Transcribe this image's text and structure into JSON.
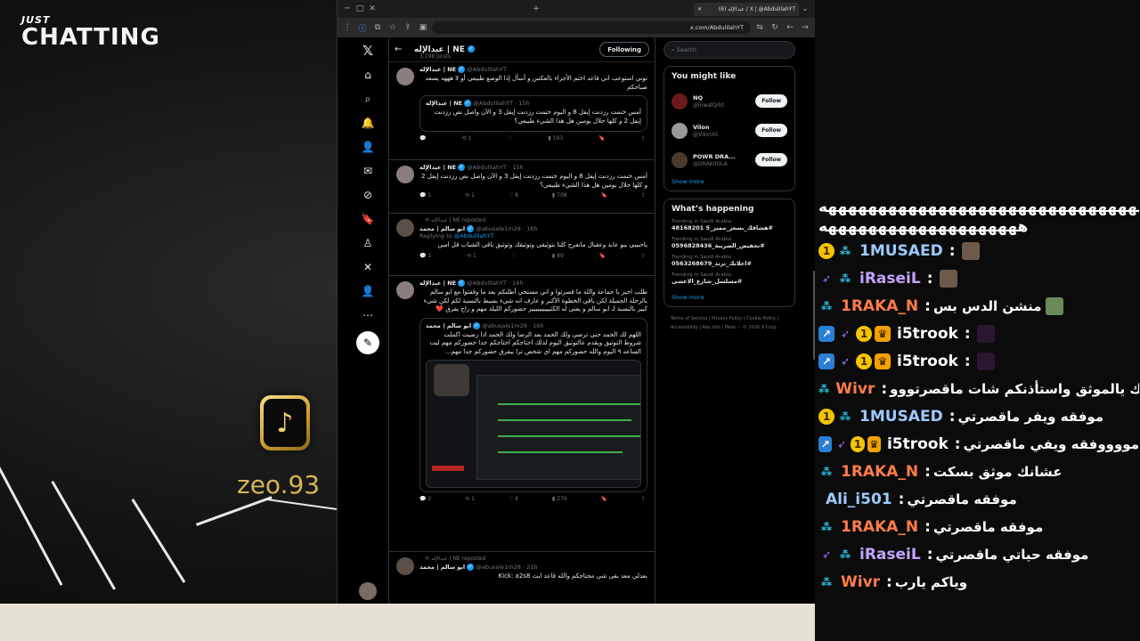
{
  "stream": {
    "category_top": "JUST",
    "category_main": "CHATTING",
    "tiktok_handle": "zeo.93",
    "tiktok_glyph": "♪"
  },
  "browser": {
    "tab_title": "عبدالإله (6) / X | @AbdulilahYT",
    "url": "x.com/AbdulilahYT"
  },
  "x": {
    "logo": "𝕏",
    "profile_name": "عبدالإله | NE",
    "post_count": "3,198 posts",
    "follow_state": "Following",
    "search_placeholder": "Search",
    "tweets": [
      {
        "author": "عبدالإله | NE",
        "handle": "@AbdulilahYT",
        "time": "",
        "text": "توني استوعب اني قاعد اختم الأجزاء بالعكس و أسأل إذا الوضع طبيعي أو لا هههه يسعد صباحكم",
        "quote_author": "عبدالإله | NE",
        "quote_handle": "@AbdulilahYT · 15h",
        "quote_text": "أمس ختمت رزدنت إيفل 8 و اليوم ختمت رزدنت إيفل 3 و الآن واصل نص رزدنت إيفل 2 و كلها خلال يومين هل هذا الشيء طبيعي؟",
        "replies": "",
        "reposts": "1",
        "likes": "",
        "views": "193"
      },
      {
        "author": "عبدالإله | NE",
        "handle": "@AbdulilahYT · 15h",
        "text": "أمس ختمت رزدنت إيفل 8 و اليوم ختمت رزدنت إيفل 3 و الآن واصل نص رزدنت إيفل 2 و كلها خلال يومين هل هذا الشيء طبيعي؟",
        "replies": "1",
        "reposts": "1",
        "likes": "8",
        "views": "708"
      },
      {
        "repost_by": "عبدالإله | NE reposted",
        "author": "ابو سالم | محمد",
        "handle": "@abusale1m28 · 16h",
        "reply_to_prefix": "Replying to",
        "reply_to": "@AbdulilahYT",
        "text": "ياحبيبي يبو عابد وعقبال مانفرح كلنا بتوثيقي وتوثيقك وتوثيق باقي الشباب قل امين",
        "replies": "1",
        "reposts": "1",
        "likes": "",
        "views": "89"
      },
      {
        "author": "عبدالإله | NE",
        "handle": "@AbdulilahYT · 16h",
        "text": "طلب اخير يا جماعة والله ما قصرتوا و اني مستحي أطلبكم بعد ما وقفتوا مع ابو سالم بالرحلة الجميلة لكن باقي الخطوة الأكبر و عارف انه شيء بسيط بالنسبة لكم لكن شيء كبير بالنسبة لـ ابو سالم و يعني له الكثيييييييييير حضوركم الليلة مهم و راح يفرق ❤️",
        "quote_author": "ابو سالم | محمد",
        "quote_handle": "@abusale1m28 · 16h",
        "quote_text": "اللهم لك الحمد حتى ترضى ولك الحمد بعد الرضا ولك الحمد اذا رضيت اكملت شروط التوثيق ويقدم عالتوثيق اليوم لذلك احتاجكم احتاجكم جدا حضوركم مهم ليت الساعه ٩ اليوم والله حضوركم مهم اي شخص ترا بيفرق حضوركم جدا مهم...",
        "replies": "2",
        "reposts": "1",
        "likes": "4",
        "views": "279"
      },
      {
        "repost_by": "عبدالإله | NE reposted",
        "author": "ابو سالم | محمد",
        "handle": "@abusale1m28 · 21h",
        "text": "بعدلي معد بقى شي محتاجكم والله قاعد ابث Kick: a2s8"
      }
    ],
    "who_to_follow": {
      "title": "You might like",
      "follow_label": "Follow",
      "show_more": "Show more",
      "accounts": [
        {
          "name": "NQ",
          "handle": "@lnwafQiht"
        },
        {
          "name": "Vilon",
          "handle": "@Vilon45"
        },
        {
          "name": "POWR DRA...",
          "handle": "@DRAK0OLA"
        }
      ]
    },
    "happening": {
      "title": "What’s happening",
      "show_more": "Show more",
      "trends": [
        {
          "context": "Trending in Saudi Arabia",
          "tag": "#هشاقك_بسعر_مميز_5 48168201"
        },
        {
          "context": "Trending in Saudi Arabia",
          "tag": "#تخفيض_الضريبة_0596828436"
        },
        {
          "context": "Trending in Saudi Arabia",
          "tag": "#اعلانك_ترند_0563268679"
        },
        {
          "context": "Trending in Saudi Arabia",
          "tag": "#مسلسل_شارع_الاعشى"
        }
      ]
    },
    "footer": {
      "links": "Terms of Service | Privacy Policy | Cookie Policy | Accessibility | Ads info | More ··· © 2026 X Corp."
    }
  },
  "chat": {
    "spam_line_1": "ههههههههههههههههههههههههههههههههههه",
    "spam_line_2": "ههههههههههههههههههههه",
    "messages": [
      {
        "user": "1MUSAED",
        "color": "#9ccaff",
        "text": ""
      },
      {
        "user": "iRaseiL",
        "color": "#c2a4ff",
        "text": ""
      },
      {
        "user": "1RAKA_N",
        "color": "#ff7b4a",
        "text": "منشن الدس بس"
      },
      {
        "user": "i5trook",
        "color": "#ffffff",
        "text": ""
      },
      {
        "user": "i5trook",
        "color": "#ffffff",
        "text": ""
      },
      {
        "user": "Wivr",
        "color": "#ff7b4a",
        "text": "استأذنك يالموثق واستأذنكم شات ماقصرتووو"
      },
      {
        "user": "1MUSAED",
        "color": "#9ccaff",
        "text": "موفقه ويفر ماقصرتي"
      },
      {
        "user": "i5trook",
        "color": "#ffffff",
        "text": "مووووفقه ويفي ماقصرتي"
      },
      {
        "user": "1RAKA_N",
        "color": "#ff7b4a",
        "text": "عشانك موثق بسكت"
      },
      {
        "user": "Ali_i501",
        "color": "#9ccaff",
        "text": "موفقه ماقصرتي"
      },
      {
        "user": "1RAKA_N",
        "color": "#ff7b4a",
        "text": "موفقه ماقصرتي"
      },
      {
        "user": "iRaseiL",
        "color": "#c2a4ff",
        "text": "موفقه حياتي ماقصرتي"
      },
      {
        "user": "Wivr",
        "color": "#ff7b4a",
        "text": "وياكم يارب"
      }
    ]
  },
  "colors": {
    "x_blue": "#1d9bf0",
    "gold": "#d6b653",
    "chat_bg": "#0b0b0b"
  }
}
